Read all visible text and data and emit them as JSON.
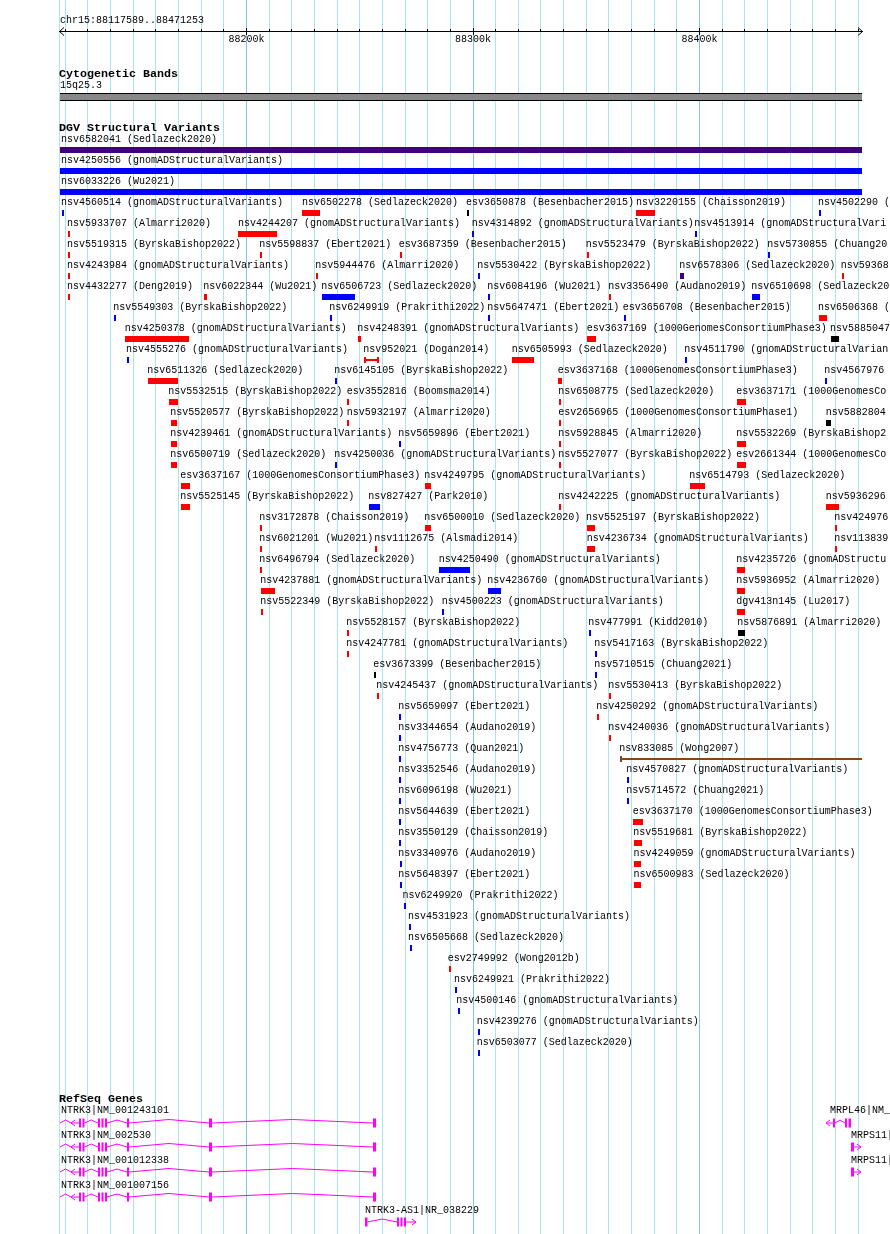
{
  "ruler": {
    "location": "chr15:88117589..88471253",
    "ticks": [
      "88200k",
      "88300k",
      "88400k"
    ]
  },
  "tracks": [
    {
      "kind": "bands",
      "title": "Cytogenetic Bands",
      "bands": [
        {
          "label": "15q25.3"
        }
      ]
    },
    {
      "kind": "variants",
      "title": "DGV Structural Variants",
      "rows": [
        [
          {
            "label": "nsv6582041 (Sedlazeck2020)",
            "color": "#400080",
            "kind": "box"
          }
        ],
        [
          {
            "label": "nsv4250556 (gnomADStructuralVariants)",
            "color": "#0000ff",
            "kind": "box"
          }
        ],
        [
          {
            "label": "nsv6033226 (Wu2021)",
            "color": "#0000ff",
            "kind": "box"
          }
        ],
        [
          {
            "label": "nsv4560514 (gnomADStructuralVariants)",
            "color": "#0000ff",
            "kind": "box"
          },
          {
            "label": "nsv6502278 (Sedlazeck2020)",
            "color": "#ff0000",
            "kind": "box"
          },
          {
            "label": "esv3650878 (Besenbacher2015)",
            "color": "#000000",
            "kind": "box"
          },
          {
            "label": "nsv3220155 (Chaisson2019)",
            "color": "#ff0000",
            "kind": "box"
          },
          {
            "label": "nsv4502290 (",
            "color": "#0000ff",
            "kind": "box"
          }
        ],
        [
          {
            "label": "nsv5933707 (Almarri2020)",
            "color": "#ff0000",
            "kind": "box"
          },
          {
            "label": "nsv4244207 (gnomADStructuralVariants)",
            "color": "#ff0000",
            "kind": "box"
          },
          {
            "label": "nsv4314892 (gnomADStructuralVariants)",
            "color": "#0000ff",
            "kind": "box"
          },
          {
            "label": "nsv4513914 (gnomADStructuralVari",
            "color": "#0000ff",
            "kind": "box"
          }
        ],
        [
          {
            "label": "nsv5519315 (ByrskaBishop2022)",
            "color": "#ff0000",
            "kind": "box"
          },
          {
            "label": "nsv5598837 (Ebert2021)",
            "color": "#ff0000",
            "kind": "box"
          },
          {
            "label": "esv3687359 (Besenbacher2015)",
            "color": "#ff0000",
            "kind": "box"
          },
          {
            "label": "nsv5523479 (ByrskaBishop2022)",
            "color": "#ff0000",
            "kind": "box"
          },
          {
            "label": "nsv5730855 (Chuang20",
            "color": "#0000ff",
            "kind": "box"
          }
        ],
        [
          {
            "label": "nsv4243984 (gnomADStructuralVariants)",
            "color": "#ff0000",
            "kind": "box"
          },
          {
            "label": "nsv5944476 (Almarri2020)",
            "color": "#ff0000",
            "kind": "box"
          },
          {
            "label": "nsv5530422 (ByrskaBishop2022)",
            "color": "#0000ff",
            "kind": "box"
          },
          {
            "label": "nsv6578306 (Sedlazeck2020)",
            "color": "#400080",
            "kind": "box"
          },
          {
            "label": "nsv59368",
            "color": "#ff0000",
            "kind": "box"
          }
        ],
        [
          {
            "label": "nsv4432277 (Deng2019)",
            "color": "#ff0000",
            "kind": "box"
          },
          {
            "label": "nsv6022344 (Wu2021)",
            "color": "#ff0000",
            "kind": "box"
          },
          {
            "label": "nsv6506723 (Sedlazeck2020)",
            "color": "#0000ff",
            "kind": "box"
          },
          {
            "label": "nsv6084196 (Wu2021)",
            "color": "#0000ff",
            "kind": "box"
          },
          {
            "label": "nsv3356490 (Audano2019)",
            "color": "#ff0000",
            "kind": "box"
          },
          {
            "label": "nsv6510698 (Sedlazeck20",
            "color": "#0000ff",
            "kind": "box"
          }
        ],
        [
          {
            "label": "nsv5549303 (ByrskaBishop2022)",
            "color": "#0000ff",
            "kind": "box"
          },
          {
            "label": "nsv6249919 (Prakrithi2022)",
            "color": "#0000ff",
            "kind": "box"
          },
          {
            "label": "nsv5647471 (Ebert2021)",
            "color": "#0000ff",
            "kind": "box"
          },
          {
            "label": "esv3656708 (Besenbacher2015)",
            "color": "#0000ff",
            "kind": "box"
          },
          {
            "label": "nsv6506368 (",
            "color": "#ff0000",
            "kind": "box"
          }
        ],
        [
          {
            "label": "nsv4250378 (gnomADStructuralVariants)",
            "color": "#ff0000",
            "kind": "box"
          },
          {
            "label": "nsv4248391 (gnomADStructuralVariants)",
            "color": "#ff0000",
            "kind": "box"
          },
          {
            "label": "esv3637169 (1000GenomesConsortiumPhase3)",
            "color": "#ff0000",
            "kind": "box"
          },
          {
            "label": "nsv5885047",
            "color": "#000000",
            "kind": "box"
          }
        ],
        [
          {
            "label": "nsv4555276 (gnomADStructuralVariants)",
            "color": "#0000ff",
            "kind": "box"
          },
          {
            "label": "nsv952021 (Dogan2014)",
            "color": "#ff0000",
            "kind": "span"
          },
          {
            "label": "nsv6505993 (Sedlazeck2020)",
            "color": "#ff0000",
            "kind": "box"
          },
          {
            "label": "nsv4511790 (gnomADStructuralVarian",
            "color": "#0000ff",
            "kind": "box"
          }
        ],
        [
          {
            "label": "nsv6511326 (Sedlazeck2020)",
            "color": "#ff0000",
            "kind": "box"
          },
          {
            "label": "nsv6145105 (ByrskaBishop2022)",
            "color": "#0000ff",
            "kind": "box"
          },
          {
            "label": "esv3637168 (1000GenomesConsortiumPhase3)",
            "color": "#ff0000",
            "kind": "box"
          },
          {
            "label": "nsv4567976",
            "color": "#0000ff",
            "kind": "box"
          }
        ],
        [
          {
            "label": "nsv5532515 (ByrskaBishop2022)",
            "color": "#ff0000",
            "kind": "box"
          },
          {
            "label": "esv3552816 (Boomsma2014)",
            "color": "#ff0000",
            "kind": "box"
          },
          {
            "label": "nsv6508775 (Sedlazeck2020)",
            "color": "#ff0000",
            "kind": "box"
          },
          {
            "label": "esv3637171 (1000GenomesCo",
            "color": "#ff0000",
            "kind": "box"
          }
        ],
        [
          {
            "label": "nsv5520577 (ByrskaBishop2022)",
            "color": "#ff0000",
            "kind": "box"
          },
          {
            "label": "nsv5932197 (Almarri2020)",
            "color": "#ff0000",
            "kind": "box"
          },
          {
            "label": "esv2656965 (1000GenomesConsortiumPhase1)",
            "color": "#ff0000",
            "kind": "box"
          },
          {
            "label": "nsv5882804",
            "color": "#000000",
            "kind": "box"
          }
        ],
        [
          {
            "label": "nsv4239461 (gnomADStructuralVariants)",
            "color": "#ff0000",
            "kind": "box"
          },
          {
            "label": "nsv5659896 (Ebert2021)",
            "color": "#0000ff",
            "kind": "box"
          },
          {
            "label": "nsv5928845 (Almarri2020)",
            "color": "#ff0000",
            "kind": "box"
          },
          {
            "label": "nsv5532269 (ByrskaBishop2",
            "color": "#ff0000",
            "kind": "box"
          }
        ],
        [
          {
            "label": "nsv6500719 (Sedlazeck2020)",
            "color": "#ff0000",
            "kind": "box"
          },
          {
            "label": "nsv4250036 (gnomADStructuralVariants)",
            "color": "#0000ff",
            "kind": "box"
          },
          {
            "label": "nsv5527077 (ByrskaBishop2022)",
            "color": "#ff0000",
            "kind": "box"
          },
          {
            "label": "esv2661344 (1000GenomesCo",
            "color": "#ff0000",
            "kind": "box"
          }
        ],
        [
          {
            "label": "esv3637167 (1000GenomesConsortiumPhase3)",
            "color": "#ff0000",
            "kind": "box"
          },
          {
            "label": "nsv4249795 (gnomADStructuralVariants)",
            "color": "#ff0000",
            "kind": "box"
          },
          {
            "label": "nsv6514793 (Sedlazeck2020)",
            "color": "#ff0000",
            "kind": "box"
          }
        ],
        [
          {
            "label": "nsv5525145 (ByrskaBishop2022)",
            "color": "#ff0000",
            "kind": "box"
          },
          {
            "label": "nsv827427 (Park2010)",
            "color": "#0000ff",
            "kind": "box"
          },
          {
            "label": "nsv4242225 (gnomADStructuralVariants)",
            "color": "#ff0000",
            "kind": "box"
          },
          {
            "label": "nsv5936296",
            "color": "#ff0000",
            "kind": "box"
          }
        ],
        [
          {
            "label": "nsv3172878 (Chaisson2019)",
            "color": "#ff0000",
            "kind": "box"
          },
          {
            "label": "nsv6500010 (Sedlazeck2020)",
            "color": "#ff0000",
            "kind": "box"
          },
          {
            "label": "nsv5525197 (ByrskaBishop2022)",
            "color": "#ff0000",
            "kind": "box"
          },
          {
            "label": "nsv424976",
            "color": "#ff0000",
            "kind": "box"
          }
        ],
        [
          {
            "label": "nsv6021201 (Wu2021)",
            "color": "#ff0000",
            "kind": "box"
          },
          {
            "label": "nsv1112675 (Alsmadi2014)",
            "color": "#ff0000",
            "kind": "box"
          },
          {
            "label": "nsv4236734 (gnomADStructuralVariants)",
            "color": "#ff0000",
            "kind": "box"
          },
          {
            "label": "nsv113839",
            "color": "#ff0000",
            "kind": "box"
          }
        ],
        [
          {
            "label": "nsv6496794 (Sedlazeck2020)",
            "color": "#ff0000",
            "kind": "box"
          },
          {
            "label": "nsv4250490 (gnomADStructuralVariants)",
            "color": "#0000ff",
            "kind": "box"
          },
          {
            "label": "nsv4235726 (gnomADStructu",
            "color": "#ff0000",
            "kind": "box"
          }
        ],
        [
          {
            "label": "nsv4237881 (gnomADStructuralVariants)",
            "color": "#ff0000",
            "kind": "box"
          },
          {
            "label": "nsv4236760 (gnomADStructuralVariants)",
            "color": "#0000ff",
            "kind": "box"
          },
          {
            "label": "nsv5936952 (Almarri2020)",
            "color": "#ff0000",
            "kind": "box"
          }
        ],
        [
          {
            "label": "nsv5522349 (ByrskaBishop2022)",
            "color": "#ff0000",
            "kind": "box"
          },
          {
            "label": "nsv4500223 (gnomADStructuralVariants)",
            "color": "#0000ff",
            "kind": "box"
          },
          {
            "label": "dgv413n145 (Lu2017)",
            "color": "#ff0000",
            "kind": "box"
          }
        ],
        [
          {
            "label": "nsv5528157 (ByrskaBishop2022)",
            "color": "#ff0000",
            "kind": "box"
          },
          {
            "label": "nsv477991 (Kidd2010)",
            "color": "#0000ff",
            "kind": "box"
          },
          {
            "label": "nsv5876891 (Almarri2020)",
            "color": "#000000",
            "kind": "box"
          }
        ],
        [
          {
            "label": "nsv4247781 (gnomADStructuralVariants)",
            "color": "#ff0000",
            "kind": "box"
          },
          {
            "label": "nsv5417163 (ByrskaBishop2022)",
            "color": "#0000ff",
            "kind": "box"
          }
        ],
        [
          {
            "label": "esv3673399 (Besenbacher2015)",
            "color": "#000000",
            "kind": "box"
          },
          {
            "label": "nsv5710515 (Chuang2021)",
            "color": "#0000ff",
            "kind": "box"
          }
        ],
        [
          {
            "label": "nsv4245437 (gnomADStructuralVariants)",
            "color": "#ff0000",
            "kind": "box"
          },
          {
            "label": "nsv5530413 (ByrskaBishop2022)",
            "color": "#ff0000",
            "kind": "box"
          }
        ],
        [
          {
            "label": "nsv5659097 (Ebert2021)",
            "color": "#0000ff",
            "kind": "box"
          },
          {
            "label": "nsv4250292 (gnomADStructuralVariants)",
            "color": "#ff0000",
            "kind": "box"
          }
        ],
        [
          {
            "label": "nsv3344654 (Audano2019)",
            "color": "#0000ff",
            "kind": "box"
          },
          {
            "label": "nsv4240036 (gnomADStructuralVariants)",
            "color": "#ff0000",
            "kind": "box"
          }
        ],
        [
          {
            "label": "nsv4756773 (Quan2021)",
            "color": "#0000ff",
            "kind": "box"
          },
          {
            "label": "nsv833085 (Wong2007)",
            "color": "#8b4513",
            "kind": "span"
          }
        ],
        [
          {
            "label": "nsv3352546 (Audano2019)",
            "color": "#0000ff",
            "kind": "box"
          },
          {
            "label": "nsv4570827 (gnomADStructuralVariants)",
            "color": "#0000ff",
            "kind": "box"
          }
        ],
        [
          {
            "label": "nsv6096198 (Wu2021)",
            "color": "#0000ff",
            "kind": "box"
          },
          {
            "label": "nsv5714572 (Chuang2021)",
            "color": "#0000ff",
            "kind": "box"
          }
        ],
        [
          {
            "label": "nsv5644639 (Ebert2021)",
            "color": "#0000ff",
            "kind": "box"
          },
          {
            "label": "esv3637170 (1000GenomesConsortiumPhase3)",
            "color": "#ff0000",
            "kind": "box"
          }
        ],
        [
          {
            "label": "nsv3550129 (Chaisson2019)",
            "color": "#0000ff",
            "kind": "box"
          },
          {
            "label": "nsv5519681 (ByrskaBishop2022)",
            "color": "#ff0000",
            "kind": "box"
          }
        ],
        [
          {
            "label": "nsv3340976 (Audano2019)",
            "color": "#0000ff",
            "kind": "box"
          },
          {
            "label": "nsv4249059 (gnomADStructuralVariants)",
            "color": "#ff0000",
            "kind": "box"
          }
        ],
        [
          {
            "label": "nsv5648397 (Ebert2021)",
            "color": "#0000ff",
            "kind": "box"
          },
          {
            "label": "nsv6500983 (Sedlazeck2020)",
            "color": "#ff0000",
            "kind": "box"
          }
        ],
        [
          {
            "label": "nsv6249920 (Prakrithi2022)",
            "color": "#0000ff",
            "kind": "box"
          }
        ],
        [
          {
            "label": "nsv4531923 (gnomADStructuralVariants)",
            "color": "#0000ff",
            "kind": "box"
          }
        ],
        [
          {
            "label": "nsv6505668 (Sedlazeck2020)",
            "color": "#0000ff",
            "kind": "box"
          }
        ],
        [
          {
            "label": "esv2749992 (Wong2012b)",
            "color": "#ff0000",
            "kind": "box"
          }
        ],
        [
          {
            "label": "nsv6249921 (Prakrithi2022)",
            "color": "#0000ff",
            "kind": "box"
          }
        ],
        [
          {
            "label": "nsv4500146 (gnomADStructuralVariants)",
            "color": "#0000ff",
            "kind": "box"
          }
        ],
        [
          {
            "label": "nsv4239276 (gnomADStructuralVariants)",
            "color": "#0000ff",
            "kind": "box"
          }
        ],
        [
          {
            "label": "nsv6503077 (Sedlazeck2020)",
            "color": "#0000ff",
            "kind": "box"
          }
        ]
      ]
    },
    {
      "kind": "genes",
      "title": "RefSeq Genes",
      "rows": [
        [
          {
            "label": "NTRK3|NM_001243101",
            "minus_strand": true
          },
          {
            "label": "MRPL46|NM_",
            "minus_strand": true
          }
        ],
        [
          {
            "label": "NTRK3|NM_002530",
            "minus_strand": true
          },
          {
            "label": "MRPS11|",
            "minus_strand": false
          }
        ],
        [
          {
            "label": "NTRK3|NM_001012338",
            "minus_strand": true
          },
          {
            "label": "MRPS11|",
            "minus_strand": false
          }
        ],
        [
          {
            "label": "NTRK3|NM_001007156",
            "minus_strand": true
          }
        ],
        [
          {
            "label": "NTRK3-AS1|NR_038229",
            "minus_strand": false
          }
        ]
      ]
    }
  ]
}
